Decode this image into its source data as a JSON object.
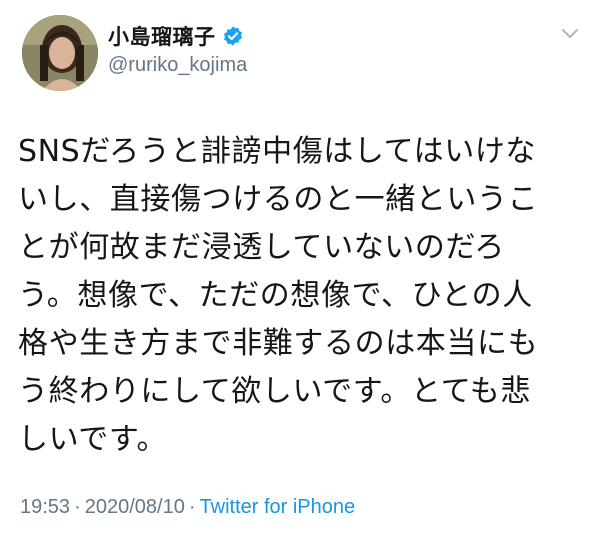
{
  "user": {
    "display_name": "小島瑠璃子",
    "username": "@ruriko_kojima",
    "verified": true,
    "avatar_icon": "profile-photo"
  },
  "tweet": {
    "lines": [
      "SNSだろうと誹謗中傷はしてはいけな",
      "いし、直接傷つけるのと一緒というこ",
      "とが何故まだ浸透していないのだろ",
      "う。想像で、ただの想像で、ひとの人",
      "格や生き方まで非難するのは本当にも",
      "う終わりにして欲しいです。とても悲",
      "しいです。"
    ],
    "time": "19:53",
    "date": "2020/08/10",
    "separator": "·",
    "source": "Twitter for iPhone"
  },
  "colors": {
    "text": "#14171a",
    "secondary": "#657786",
    "link": "#1b95e0",
    "verified": "#1da1f2"
  },
  "icons": {
    "verified": "verified-badge-icon",
    "menu": "chevron-down-icon"
  }
}
